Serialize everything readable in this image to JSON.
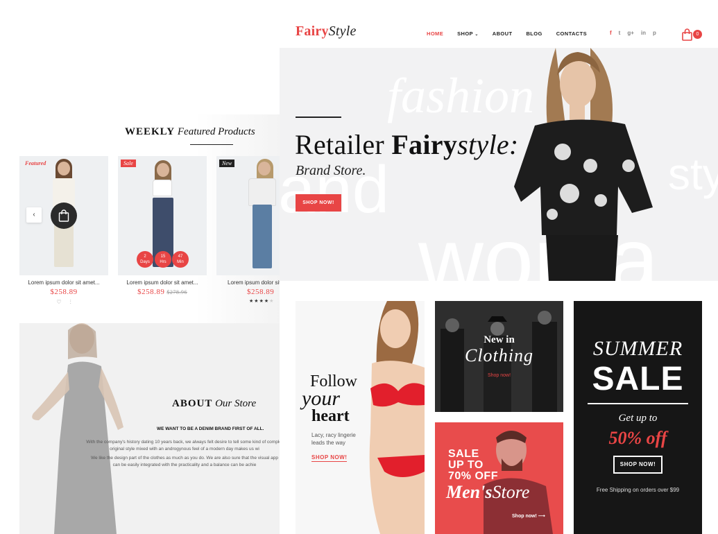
{
  "back_page": {
    "weekly": {
      "title_bold": "WEEKLY",
      "title_italic": "Featured Products"
    },
    "products": [
      {
        "badge": "Featured",
        "name": "Lorem ipsum dolor sit amet...",
        "price": "$258.89",
        "old_price": "",
        "timer": []
      },
      {
        "badge": "Sale",
        "name": "Lorem ipsum dolor sit amet...",
        "price": "$258.89",
        "old_price": "$278.96",
        "timer": [
          {
            "value": "2",
            "unit": "Days"
          },
          {
            "value": "15",
            "unit": "Hrs"
          },
          {
            "value": "47",
            "unit": "Min"
          }
        ]
      },
      {
        "badge": "New",
        "name": "Lorem ipsum dolor sit amet...",
        "price": "$258.89",
        "old_price": "",
        "rating": 4,
        "rating_max": 5,
        "timer": []
      }
    ],
    "slider_prev_icon": "chevron-left-icon",
    "about": {
      "title_bold": "ABOUT",
      "title_italic": "Our Store",
      "subtitle": "WE WANT TO BE A DENIM BRAND FIRST OF ALL.",
      "paragraph1_line1": "With the company's history dating 10 years back, we always felt desire to tell some kind of complet",
      "paragraph1_line2": "original style mixed with an androgynous feel of a modern day makes us wi",
      "paragraph2_line1": "We like the design part of the clothes as much as you do. We are also sure that the visual app",
      "paragraph2_line2": "can be easily integrated with the practicality and a balance can be achie"
    }
  },
  "header": {
    "logo_part1": "Fairy",
    "logo_part2": "Style",
    "nav": [
      {
        "label": "HOME",
        "active": true
      },
      {
        "label": "SHOP",
        "dropdown": true
      },
      {
        "label": "ABOUT"
      },
      {
        "label": "BLOG"
      },
      {
        "label": "CONTACTS"
      }
    ],
    "social": [
      "f",
      "t",
      "g+",
      "in",
      "p"
    ],
    "cart_count": "0"
  },
  "hero": {
    "bg_word_1": "fashion",
    "bg_word_2": "and",
    "bg_word_3": "woma",
    "bg_word_4": "sty",
    "title_regular": "Retailer ",
    "title_bold": "Fairy",
    "title_italic": "style:",
    "subtitle": "Brand Store.",
    "button": "SHOP NOW!"
  },
  "promos": {
    "follow": {
      "line1": "Follow",
      "line2": "your",
      "line3": "heart",
      "description": "Lacy, racy lingerie leads the way",
      "link": "SHOP NOW!"
    },
    "clothing": {
      "line1": "New in",
      "line2": "Clothing",
      "link": "Shop now!"
    },
    "men": {
      "line1": "SALE",
      "line2": "UP TO",
      "line3": "70% OFF",
      "store_bold": "Men's",
      "store_italic": "Store",
      "link": "Shop now!"
    },
    "summer": {
      "line1": "SUMMER",
      "line2": "SALE",
      "line3": "Get up to",
      "line4": "50% off",
      "button": "SHOP NOW!",
      "note": "Free Shipping on orders over $99"
    }
  },
  "colors": {
    "accent": "#e84545",
    "dark": "#161616",
    "hero_bg": "#f2f2f3"
  }
}
